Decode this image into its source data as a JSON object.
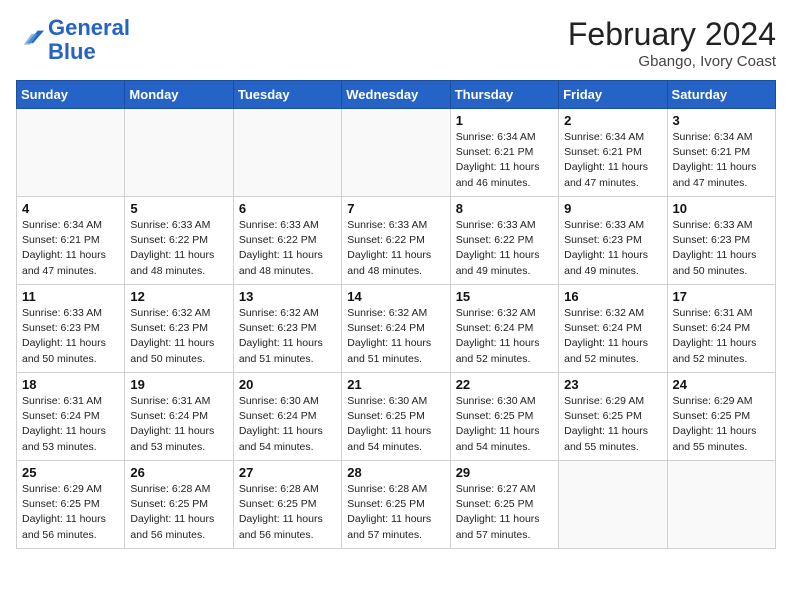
{
  "header": {
    "logo_general": "General",
    "logo_blue": "Blue",
    "month_year": "February 2024",
    "location": "Gbango, Ivory Coast"
  },
  "weekdays": [
    "Sunday",
    "Monday",
    "Tuesday",
    "Wednesday",
    "Thursday",
    "Friday",
    "Saturday"
  ],
  "weeks": [
    [
      {
        "day": "",
        "info": ""
      },
      {
        "day": "",
        "info": ""
      },
      {
        "day": "",
        "info": ""
      },
      {
        "day": "",
        "info": ""
      },
      {
        "day": "1",
        "info": "Sunrise: 6:34 AM\nSunset: 6:21 PM\nDaylight: 11 hours and 46 minutes."
      },
      {
        "day": "2",
        "info": "Sunrise: 6:34 AM\nSunset: 6:21 PM\nDaylight: 11 hours and 47 minutes."
      },
      {
        "day": "3",
        "info": "Sunrise: 6:34 AM\nSunset: 6:21 PM\nDaylight: 11 hours and 47 minutes."
      }
    ],
    [
      {
        "day": "4",
        "info": "Sunrise: 6:34 AM\nSunset: 6:21 PM\nDaylight: 11 hours and 47 minutes."
      },
      {
        "day": "5",
        "info": "Sunrise: 6:33 AM\nSunset: 6:22 PM\nDaylight: 11 hours and 48 minutes."
      },
      {
        "day": "6",
        "info": "Sunrise: 6:33 AM\nSunset: 6:22 PM\nDaylight: 11 hours and 48 minutes."
      },
      {
        "day": "7",
        "info": "Sunrise: 6:33 AM\nSunset: 6:22 PM\nDaylight: 11 hours and 48 minutes."
      },
      {
        "day": "8",
        "info": "Sunrise: 6:33 AM\nSunset: 6:22 PM\nDaylight: 11 hours and 49 minutes."
      },
      {
        "day": "9",
        "info": "Sunrise: 6:33 AM\nSunset: 6:23 PM\nDaylight: 11 hours and 49 minutes."
      },
      {
        "day": "10",
        "info": "Sunrise: 6:33 AM\nSunset: 6:23 PM\nDaylight: 11 hours and 50 minutes."
      }
    ],
    [
      {
        "day": "11",
        "info": "Sunrise: 6:33 AM\nSunset: 6:23 PM\nDaylight: 11 hours and 50 minutes."
      },
      {
        "day": "12",
        "info": "Sunrise: 6:32 AM\nSunset: 6:23 PM\nDaylight: 11 hours and 50 minutes."
      },
      {
        "day": "13",
        "info": "Sunrise: 6:32 AM\nSunset: 6:23 PM\nDaylight: 11 hours and 51 minutes."
      },
      {
        "day": "14",
        "info": "Sunrise: 6:32 AM\nSunset: 6:24 PM\nDaylight: 11 hours and 51 minutes."
      },
      {
        "day": "15",
        "info": "Sunrise: 6:32 AM\nSunset: 6:24 PM\nDaylight: 11 hours and 52 minutes."
      },
      {
        "day": "16",
        "info": "Sunrise: 6:32 AM\nSunset: 6:24 PM\nDaylight: 11 hours and 52 minutes."
      },
      {
        "day": "17",
        "info": "Sunrise: 6:31 AM\nSunset: 6:24 PM\nDaylight: 11 hours and 52 minutes."
      }
    ],
    [
      {
        "day": "18",
        "info": "Sunrise: 6:31 AM\nSunset: 6:24 PM\nDaylight: 11 hours and 53 minutes."
      },
      {
        "day": "19",
        "info": "Sunrise: 6:31 AM\nSunset: 6:24 PM\nDaylight: 11 hours and 53 minutes."
      },
      {
        "day": "20",
        "info": "Sunrise: 6:30 AM\nSunset: 6:24 PM\nDaylight: 11 hours and 54 minutes."
      },
      {
        "day": "21",
        "info": "Sunrise: 6:30 AM\nSunset: 6:25 PM\nDaylight: 11 hours and 54 minutes."
      },
      {
        "day": "22",
        "info": "Sunrise: 6:30 AM\nSunset: 6:25 PM\nDaylight: 11 hours and 54 minutes."
      },
      {
        "day": "23",
        "info": "Sunrise: 6:29 AM\nSunset: 6:25 PM\nDaylight: 11 hours and 55 minutes."
      },
      {
        "day": "24",
        "info": "Sunrise: 6:29 AM\nSunset: 6:25 PM\nDaylight: 11 hours and 55 minutes."
      }
    ],
    [
      {
        "day": "25",
        "info": "Sunrise: 6:29 AM\nSunset: 6:25 PM\nDaylight: 11 hours and 56 minutes."
      },
      {
        "day": "26",
        "info": "Sunrise: 6:28 AM\nSunset: 6:25 PM\nDaylight: 11 hours and 56 minutes."
      },
      {
        "day": "27",
        "info": "Sunrise: 6:28 AM\nSunset: 6:25 PM\nDaylight: 11 hours and 56 minutes."
      },
      {
        "day": "28",
        "info": "Sunrise: 6:28 AM\nSunset: 6:25 PM\nDaylight: 11 hours and 57 minutes."
      },
      {
        "day": "29",
        "info": "Sunrise: 6:27 AM\nSunset: 6:25 PM\nDaylight: 11 hours and 57 minutes."
      },
      {
        "day": "",
        "info": ""
      },
      {
        "day": "",
        "info": ""
      }
    ]
  ]
}
